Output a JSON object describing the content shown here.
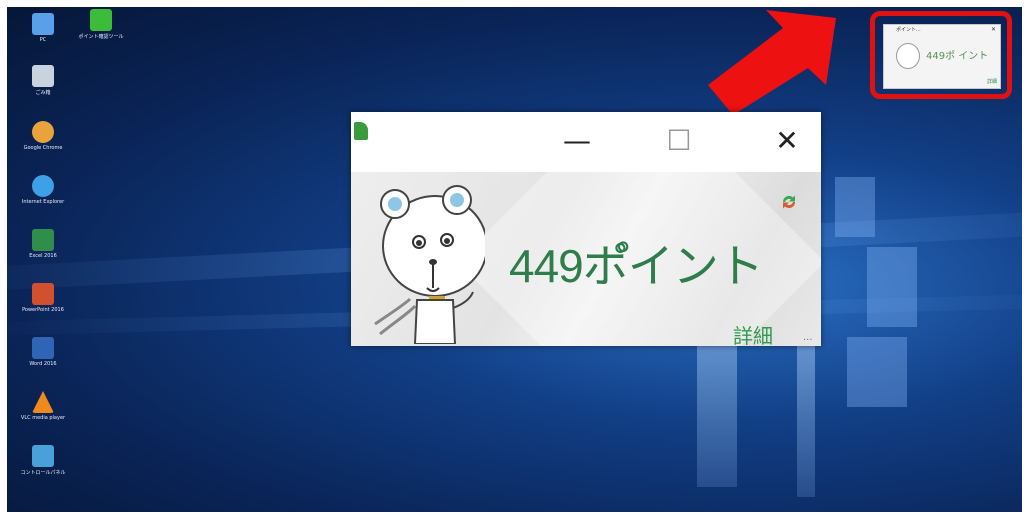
{
  "desktop": {
    "icons": [
      {
        "name": "pc-icon",
        "label": "PC",
        "color": "#5aa0e8"
      },
      {
        "name": "recycle-bin-icon",
        "label": "ごみ箱",
        "color": "#c9d3df"
      },
      {
        "name": "chrome-icon",
        "label": "Google Chrome",
        "color": "#e8a33a"
      },
      {
        "name": "internet-explorer-icon",
        "label": "Internet Explorer",
        "color": "#3ea0e6"
      },
      {
        "name": "excel-icon",
        "label": "Excel 2016",
        "color": "#2f8f4a"
      },
      {
        "name": "powerpoint-icon",
        "label": "PowerPoint 2016",
        "color": "#d2502e"
      },
      {
        "name": "word-icon",
        "label": "Word 2016",
        "color": "#2f64b6"
      },
      {
        "name": "vlc-icon",
        "label": "VLC media player",
        "color": "#f08a1c"
      },
      {
        "name": "control-panel-icon",
        "label": "コントロールパネル",
        "color": "#4aa0d8"
      },
      {
        "name": "points-app-shortcut-icon",
        "label": "ポイント確認ツール",
        "color": "#3bbd3b"
      }
    ]
  },
  "thumbnail": {
    "title": "ポイント...",
    "points": "449ポ イント",
    "details": "詳細"
  },
  "popup": {
    "minimize": "—",
    "maximize": "☐",
    "close": "✕",
    "points": "449ポ゚イント",
    "details": "詳細",
    "ellipsis": "..."
  },
  "colors": {
    "accent_green": "#2f7d4a",
    "highlight_red": "#e11111"
  }
}
